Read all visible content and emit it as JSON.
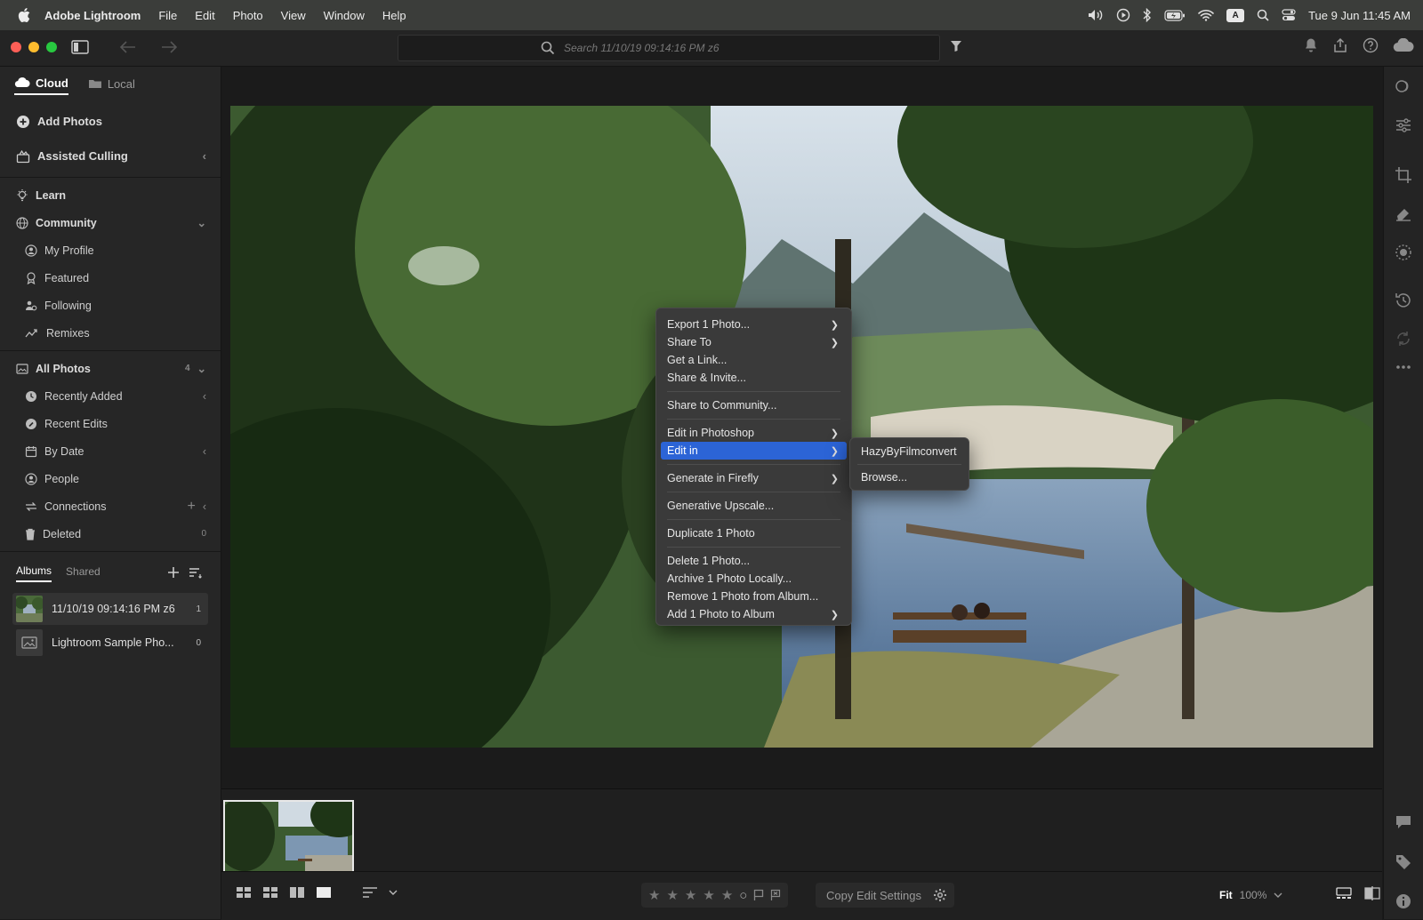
{
  "menubar": {
    "app_name": "Adobe Lightroom",
    "items": [
      "File",
      "Edit",
      "Photo",
      "View",
      "Window",
      "Help"
    ],
    "input_indicator": "A",
    "clock": "Tue 9 Jun  11:45 AM"
  },
  "toolbar": {
    "search_placeholder": "Search 11/10/19 09:14:16 PM z6"
  },
  "sidebar": {
    "source_tabs": [
      "Cloud",
      "Local"
    ],
    "add_photos": "Add Photos",
    "assisted_culling": "Assisted Culling",
    "learn": "Learn",
    "community": "Community",
    "community_items": [
      "My Profile",
      "Featured",
      "Following",
      "Remixes"
    ],
    "all_photos": "All Photos",
    "all_photos_count": "4",
    "library_items": [
      {
        "label": "Recently Added",
        "count": ""
      },
      {
        "label": "Recent Edits",
        "count": ""
      },
      {
        "label": "By Date",
        "count": ""
      },
      {
        "label": "People",
        "count": ""
      },
      {
        "label": "Connections",
        "count": ""
      },
      {
        "label": "Deleted",
        "count": "0"
      }
    ],
    "album_tabs": [
      "Albums",
      "Shared"
    ],
    "albums": [
      {
        "name": "11/10/19 09:14:16 PM z6",
        "count": "1"
      },
      {
        "name": "Lightroom Sample Pho...",
        "count": "0"
      }
    ]
  },
  "context_menu": {
    "items": [
      {
        "label": "Export 1 Photo...",
        "arrow": true
      },
      {
        "label": "Share To",
        "arrow": true
      },
      {
        "label": "Get a Link...",
        "arrow": false
      },
      {
        "label": "Share & Invite...",
        "arrow": false
      },
      {
        "label": "Share to Community...",
        "arrow": false
      },
      {
        "label": "Edit in Photoshop",
        "arrow": true
      },
      {
        "label": "Edit in",
        "arrow": true
      },
      {
        "label": "Generate in Firefly",
        "arrow": true
      },
      {
        "label": "Generative Upscale...",
        "arrow": false
      },
      {
        "label": "Duplicate 1 Photo",
        "arrow": false
      },
      {
        "label": "Delete 1 Photo...",
        "arrow": false
      },
      {
        "label": "Archive 1 Photo Locally...",
        "arrow": false
      },
      {
        "label": "Remove 1 Photo from Album...",
        "arrow": false
      },
      {
        "label": "Add 1 Photo to Album",
        "arrow": true
      }
    ],
    "submenu": [
      "HazyByFilmconvert",
      "Browse..."
    ]
  },
  "bottombar": {
    "copy_edit_settings": "Copy Edit Settings",
    "zoom_fit": "Fit",
    "zoom_pct": "100%"
  },
  "colors": {
    "accent": "#2c64d6",
    "menubar": "#3b3d3a",
    "sidebar": "#262626"
  }
}
